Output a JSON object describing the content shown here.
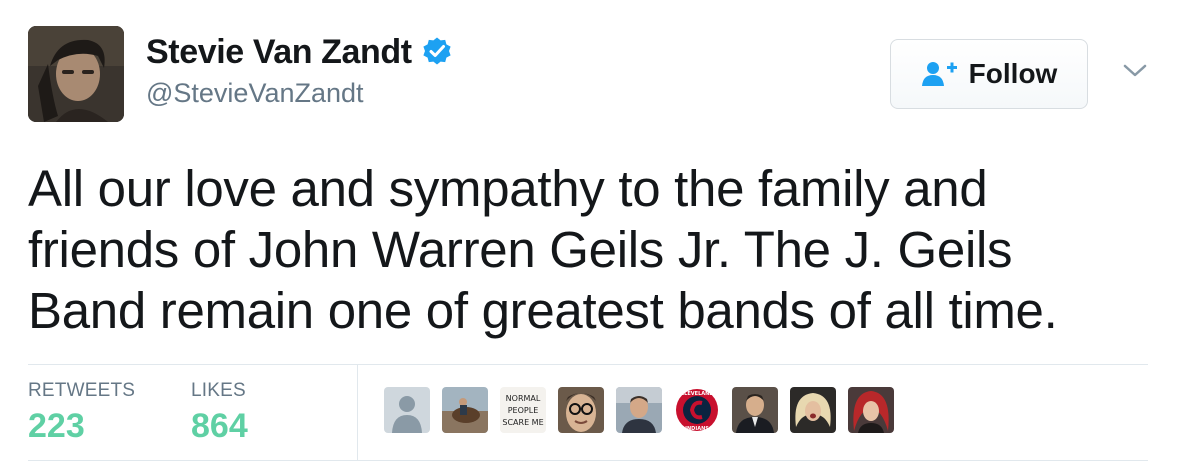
{
  "author": {
    "display_name": "Stevie Van Zandt",
    "handle": "@StevieVanZandt",
    "verified": true,
    "avatar_icon": "user-photo-avatar"
  },
  "follow_button": {
    "label": "Follow",
    "icon": "add-user-icon"
  },
  "menu_icon": "chevron-down-icon",
  "tweet": {
    "lines": [
      "All our love and sympathy to the family and",
      "friends of John Warren Geils Jr. The J. Geils",
      "Band remain one of greatest bands of all time."
    ]
  },
  "stats": {
    "retweets_label": "RETWEETS",
    "retweets_value": "223",
    "likes_label": "LIKES",
    "likes_value": "864"
  },
  "likers": [
    {
      "name": "default-avatar"
    },
    {
      "name": "horse-photo-avatar"
    },
    {
      "name": "normal-people-scare-me-avatar",
      "text": [
        "NORMAL",
        "PEOPLE",
        "SCARE ME"
      ]
    },
    {
      "name": "glasses-man-avatar"
    },
    {
      "name": "man-portrait-avatar"
    },
    {
      "name": "cleveland-indians-logo-avatar",
      "text": [
        "CLEVELAND",
        "INDIANS"
      ]
    },
    {
      "name": "man-suit-avatar"
    },
    {
      "name": "blonde-singer-avatar"
    },
    {
      "name": "red-hair-avatar"
    }
  ],
  "colors": {
    "stat_value": "#5fd0a4",
    "verified_blue": "#1da1f2",
    "follow_icon_blue": "#1da1f2",
    "secondary_text": "#657786",
    "divider": "#e1e8ed"
  }
}
